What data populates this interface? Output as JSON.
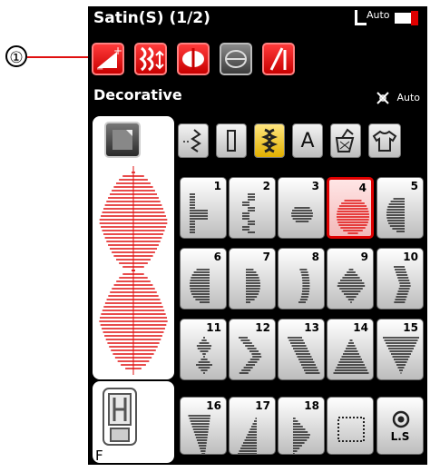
{
  "callout": {
    "number": "①"
  },
  "header": {
    "title": "Satin(S) (1/2)",
    "auto": "Auto"
  },
  "toolbar": {
    "buttons": [
      {
        "name": "auto-tension-button",
        "icon": "tension-plus-minus-icon"
      },
      {
        "name": "mirror-elongation-button",
        "icon": "elongation-icon"
      },
      {
        "name": "mirror-image-button",
        "icon": "mirror-icon"
      },
      {
        "name": "twin-needle-button",
        "icon": "twin-needle-icon"
      },
      {
        "name": "needle-button",
        "icon": "needle-icon"
      }
    ]
  },
  "mode": {
    "label": "Decorative",
    "auto": "Auto"
  },
  "tabs": [
    {
      "name": "tab-utility",
      "icon": "utility-stitch-icon",
      "active": false
    },
    {
      "name": "tab-buttonhole",
      "icon": "buttonhole-icon",
      "active": false
    },
    {
      "name": "tab-decorative",
      "icon": "decorative-stitch-icon",
      "active": true
    },
    {
      "name": "tab-alphabet",
      "icon": "alphabet-icon",
      "letter": "A",
      "active": false
    },
    {
      "name": "tab-quilt",
      "icon": "quilt-icon",
      "active": false
    },
    {
      "name": "tab-heirloom",
      "icon": "shirt-icon",
      "active": false
    }
  ],
  "foot": {
    "letter": "F"
  },
  "stitches": [
    {
      "n": "1"
    },
    {
      "n": "2"
    },
    {
      "n": "3"
    },
    {
      "n": "4",
      "selected": true
    },
    {
      "n": "5"
    },
    {
      "n": "6"
    },
    {
      "n": "7"
    },
    {
      "n": "8"
    },
    {
      "n": "9"
    },
    {
      "n": "10"
    },
    {
      "n": "11"
    },
    {
      "n": "12"
    },
    {
      "n": "13"
    },
    {
      "n": "14"
    },
    {
      "n": "15"
    },
    {
      "n": "16"
    },
    {
      "n": "17"
    },
    {
      "n": "18"
    },
    {
      "n": ""
    },
    {
      "n": "",
      "label": "L.S"
    }
  ],
  "colors": {
    "accent_red": "#e00000",
    "active_tab": "#f2c200",
    "stitch_red": "#e01010"
  }
}
